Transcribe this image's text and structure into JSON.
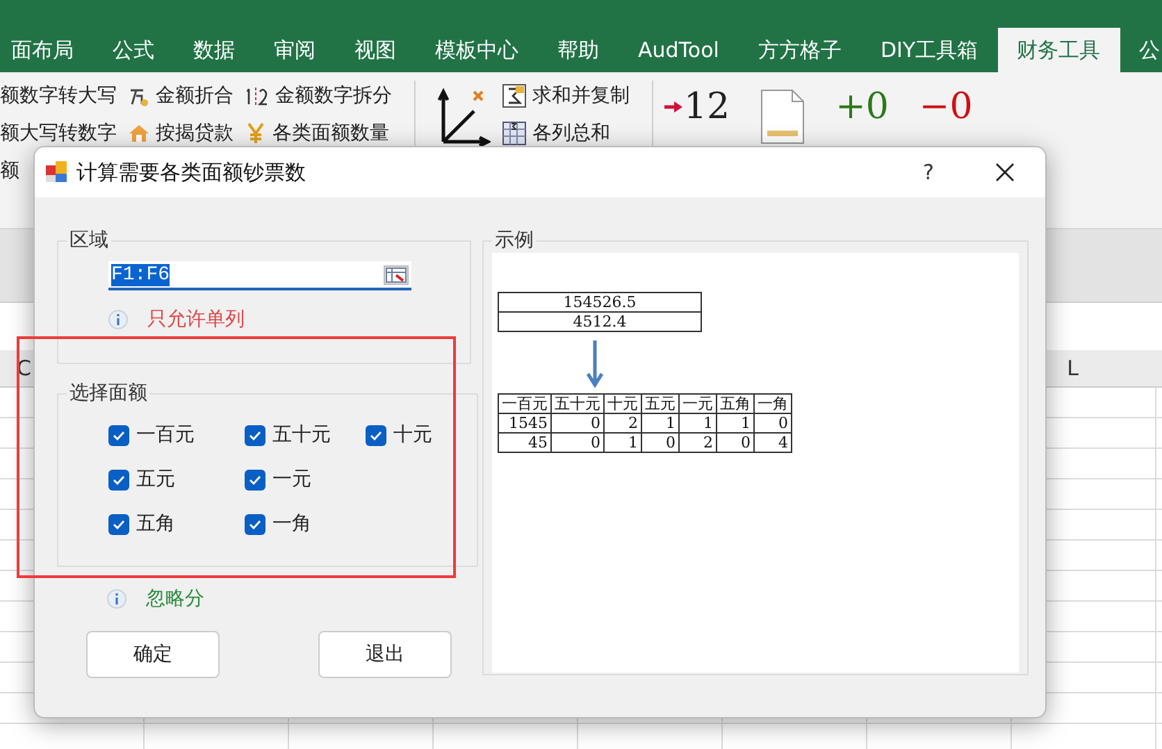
{
  "ribbon_tabs": [
    {
      "label": "面布局",
      "selected": false
    },
    {
      "label": "公式",
      "selected": false
    },
    {
      "label": "数据",
      "selected": false
    },
    {
      "label": "审阅",
      "selected": false
    },
    {
      "label": "视图",
      "selected": false
    },
    {
      "label": "模板中心",
      "selected": false
    },
    {
      "label": "帮助",
      "selected": false
    },
    {
      "label": "AudTool",
      "selected": false
    },
    {
      "label": "方方格子",
      "selected": false
    },
    {
      "label": "DIY工具箱",
      "selected": false
    },
    {
      "label": "财务工具",
      "selected": true
    },
    {
      "label": "公",
      "selected": false
    }
  ],
  "ribbon_columns": [
    {
      "items": [
        {
          "label": "额数字转大写"
        },
        {
          "label": "额大写转数字"
        },
        {
          "label": "额"
        }
      ]
    },
    {
      "items": [
        {
          "label": "金额折合"
        },
        {
          "label": "按揭贷款"
        }
      ]
    },
    {
      "items": [
        {
          "label": "金额数字拆分"
        },
        {
          "label": "各类面额数量"
        }
      ]
    },
    {
      "items": [
        {
          "label": "求和并复制"
        },
        {
          "label": "各列总和"
        }
      ]
    }
  ],
  "ribbon_big_buttons": [
    {
      "kind": "arrow",
      "glyph": "12"
    },
    {
      "kind": "doc"
    },
    {
      "kind": "plus",
      "glyph": "+0"
    },
    {
      "kind": "minus",
      "glyph": "−0"
    }
  ],
  "column_headers": [
    "C",
    "L"
  ],
  "dialog": {
    "title": "计算需要各类面额钞票数",
    "help": "?",
    "range_group": {
      "legend": "区域",
      "value": "F1:F6",
      "hint": "只允许单列"
    },
    "denomination_group": {
      "legend": "选择面额",
      "rows": [
        [
          {
            "label": "一百元",
            "checked": true
          },
          {
            "label": "五十元",
            "checked": true
          },
          {
            "label": "十元",
            "checked": true
          }
        ],
        [
          {
            "label": "五元",
            "checked": true
          },
          {
            "label": "一元",
            "checked": true
          }
        ],
        [
          {
            "label": "五角",
            "checked": true
          },
          {
            "label": "一角",
            "checked": true
          }
        ]
      ]
    },
    "note": "忽略分",
    "buttons": [
      "确定",
      "退出"
    ],
    "example": {
      "legend": "示例",
      "inputs": [
        "154526.5",
        "4512.4"
      ],
      "columns": [
        "一百元",
        "五十元",
        "十元",
        "五元",
        "一元",
        "五角",
        "一角"
      ],
      "rows": [
        [
          "1545",
          "0",
          "2",
          "1",
          "1",
          "1",
          "0"
        ],
        [
          "45",
          "0",
          "1",
          "0",
          "2",
          "0",
          "4"
        ]
      ]
    }
  }
}
